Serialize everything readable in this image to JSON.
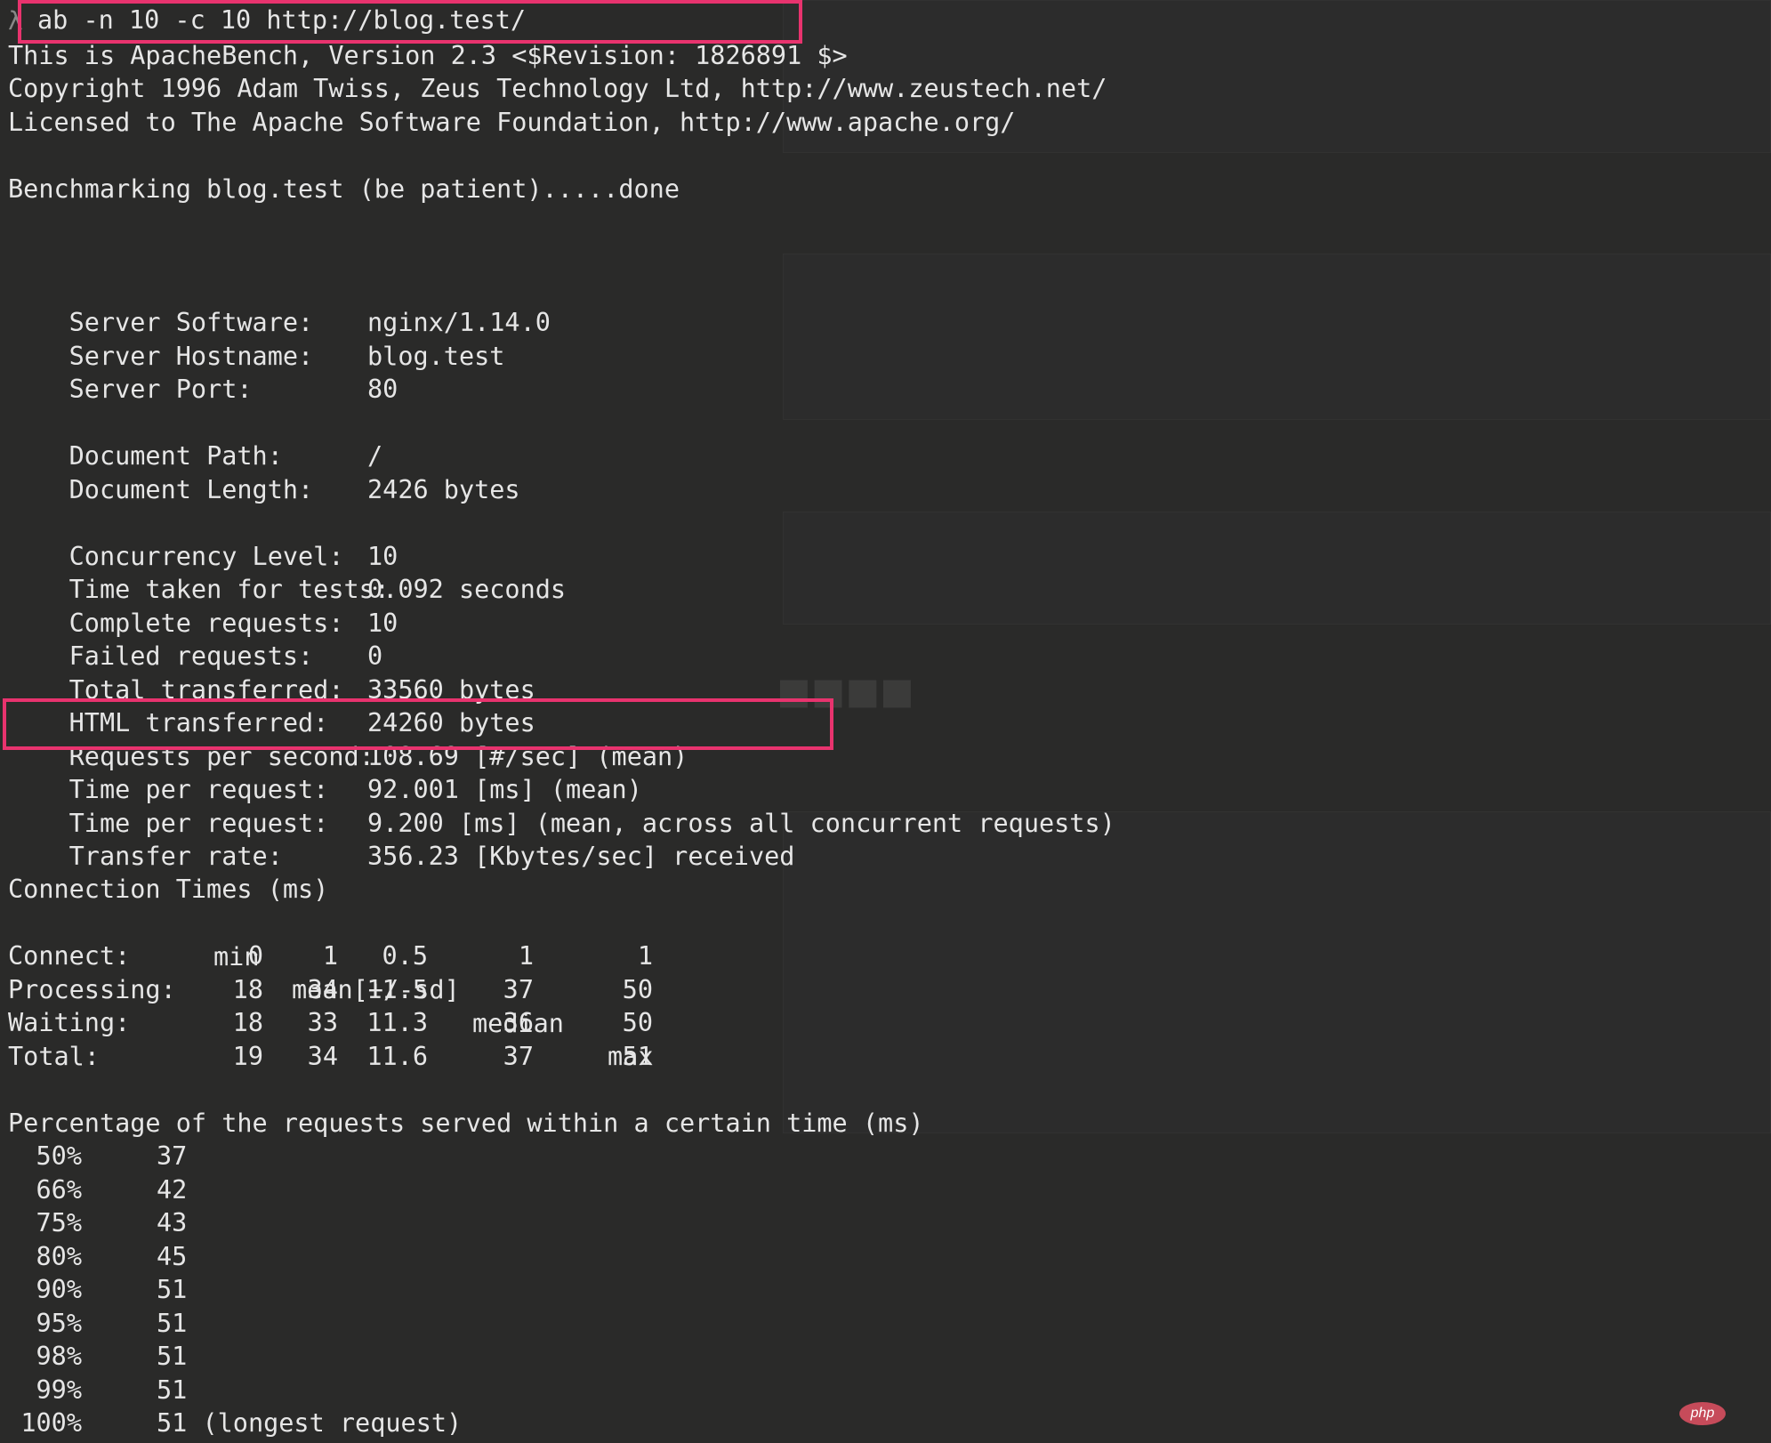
{
  "terminal": {
    "prompt_char": "λ",
    "command": "ab -n 10 -c 10 http://blog.test/",
    "banner": [
      "This is ApacheBench, Version 2.3 <$Revision: 1826891 $>",
      "Copyright 1996 Adam Twiss, Zeus Technology Ltd, http://www.zeustech.net/",
      "Licensed to The Apache Software Foundation, http://www.apache.org/"
    ],
    "benchmarking": "Benchmarking blog.test (be patient).....done",
    "server": [
      {
        "label": "Server Software:",
        "value": "nginx/1.14.0"
      },
      {
        "label": "Server Hostname:",
        "value": "blog.test"
      },
      {
        "label": "Server Port:",
        "value": "80"
      }
    ],
    "document": [
      {
        "label": "Document Path:",
        "value": "/"
      },
      {
        "label": "Document Length:",
        "value": "2426 bytes"
      }
    ],
    "stats": [
      {
        "label": "Concurrency Level:",
        "value": "10"
      },
      {
        "label": "Time taken for tests:",
        "value": "0.092 seconds"
      },
      {
        "label": "Complete requests:",
        "value": "10"
      },
      {
        "label": "Failed requests:",
        "value": "0"
      },
      {
        "label": "Total transferred:",
        "value": "33560 bytes"
      },
      {
        "label": "HTML transferred:",
        "value": "24260 bytes"
      },
      {
        "label": "Requests per second:",
        "value": "108.69 [#/sec] (mean)"
      },
      {
        "label": "Time per request:",
        "value": "92.001 [ms] (mean)"
      },
      {
        "label": "Time per request:",
        "value": "9.200 [ms] (mean, across all concurrent requests)"
      },
      {
        "label": "Transfer rate:",
        "value": "356.23 [Kbytes/sec] received"
      }
    ],
    "connection_times": {
      "title": "Connection Times (ms)",
      "headers": [
        "min",
        "mean[+/-sd]",
        "median",
        "max"
      ],
      "rows": [
        {
          "label": "Connect:",
          "min": "0",
          "mean": "1",
          "sd": "0.5",
          "median": "1",
          "max": "1"
        },
        {
          "label": "Processing:",
          "min": "18",
          "mean": "34",
          "sd": "11.5",
          "median": "37",
          "max": "50"
        },
        {
          "label": "Waiting:",
          "min": "18",
          "mean": "33",
          "sd": "11.3",
          "median": "36",
          "max": "50"
        },
        {
          "label": "Total:",
          "min": "19",
          "mean": "34",
          "sd": "11.6",
          "median": "37",
          "max": "51"
        }
      ]
    },
    "percentiles": {
      "title": "Percentage of the requests served within a certain time (ms)",
      "rows": [
        {
          "p": "50%",
          "v": "37"
        },
        {
          "p": "66%",
          "v": "42"
        },
        {
          "p": "75%",
          "v": "43"
        },
        {
          "p": "80%",
          "v": "45"
        },
        {
          "p": "90%",
          "v": "51"
        },
        {
          "p": "95%",
          "v": "51"
        },
        {
          "p": "98%",
          "v": "51"
        },
        {
          "p": "99%",
          "v": "51"
        },
        {
          "p": "100%",
          "v": "51 (longest request)"
        }
      ]
    }
  },
  "watermark": "php",
  "colors": {
    "highlight": "#e8336e",
    "terminal_bg": "#2a2a29",
    "text": "#e6e6e6"
  }
}
